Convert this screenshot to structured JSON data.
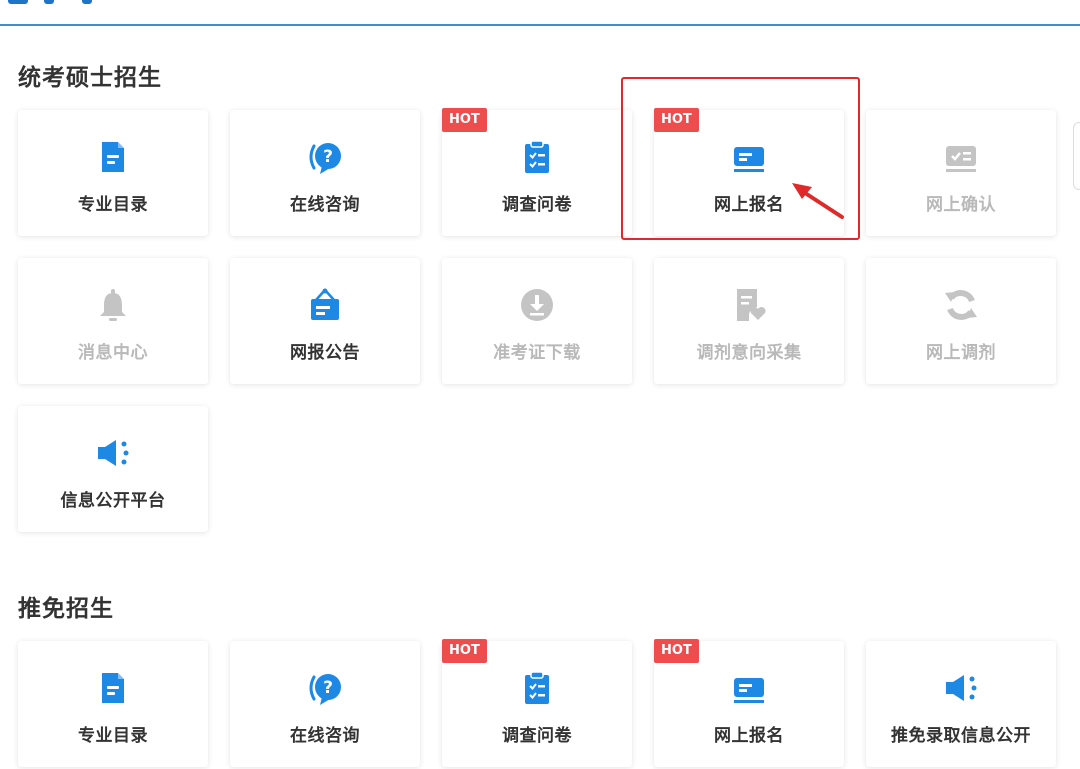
{
  "colors": {
    "accent": "#1e74c6",
    "icon_blue": "#1e88e5",
    "icon_disabled": "#c4c4c4",
    "hot_badge": "#ee4d4d",
    "highlight_box": "#e02a2a"
  },
  "badge_text": "HOT",
  "sections": [
    {
      "title": "统考硕士招生",
      "cards": [
        {
          "label": "专业目录",
          "icon": "document-icon",
          "hot": false,
          "disabled": false
        },
        {
          "label": "在线咨询",
          "icon": "question-chat-icon",
          "hot": false,
          "disabled": false
        },
        {
          "label": "调查问卷",
          "icon": "clipboard-checklist-icon",
          "hot": true,
          "disabled": false
        },
        {
          "label": "网上报名",
          "icon": "card-form-icon",
          "hot": true,
          "disabled": false,
          "highlighted": true
        },
        {
          "label": "网上确认",
          "icon": "card-check-icon",
          "hot": false,
          "disabled": true
        },
        {
          "label": "消息中心",
          "icon": "bell-icon",
          "hot": false,
          "disabled": true
        },
        {
          "label": "网报公告",
          "icon": "notice-board-icon",
          "hot": false,
          "disabled": false
        },
        {
          "label": "准考证下载",
          "icon": "download-icon",
          "hot": false,
          "disabled": true
        },
        {
          "label": "调剂意向采集",
          "icon": "document-heart-icon",
          "hot": false,
          "disabled": true
        },
        {
          "label": "网上调剂",
          "icon": "refresh-icon",
          "hot": false,
          "disabled": true
        },
        {
          "label": "信息公开平台",
          "icon": "megaphone-icon",
          "hot": false,
          "disabled": false
        }
      ]
    },
    {
      "title": "推免招生",
      "cards": [
        {
          "label": "专业目录",
          "icon": "document-icon",
          "hot": false,
          "disabled": false
        },
        {
          "label": "在线咨询",
          "icon": "question-chat-icon",
          "hot": false,
          "disabled": false
        },
        {
          "label": "调查问卷",
          "icon": "clipboard-checklist-icon",
          "hot": true,
          "disabled": false
        },
        {
          "label": "网上报名",
          "icon": "card-form-icon",
          "hot": true,
          "disabled": false
        },
        {
          "label": "推免录取信息公开",
          "icon": "megaphone-icon",
          "hot": false,
          "disabled": false
        }
      ]
    }
  ]
}
